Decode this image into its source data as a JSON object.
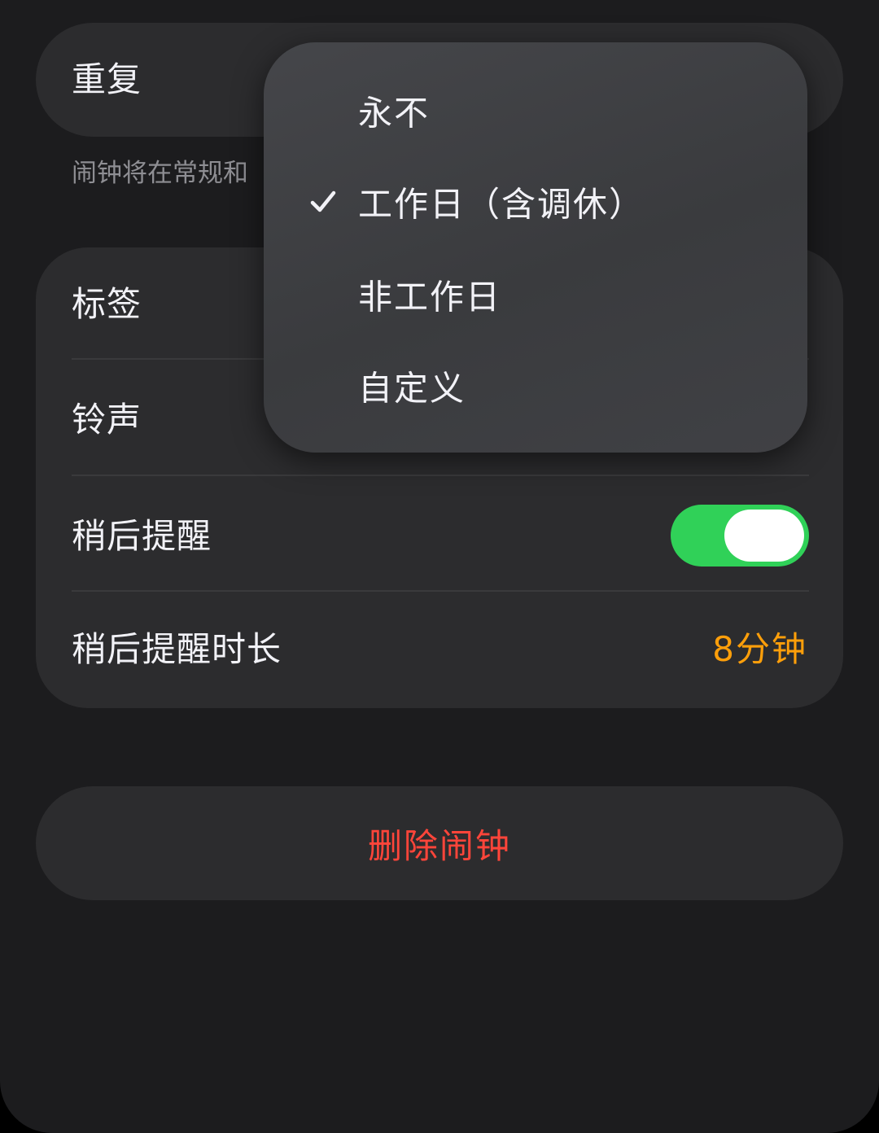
{
  "repeat": {
    "label": "重复",
    "hint": "闹钟将在常规和"
  },
  "settings": {
    "label_row": "标签",
    "ringtone_row": "铃声",
    "snooze_row": "稍后提醒",
    "snooze_enabled": true,
    "snooze_duration_row": "稍后提醒时长",
    "snooze_duration_value": "8分钟"
  },
  "delete_button": "删除闹钟",
  "dropdown": {
    "items": [
      {
        "label": "永不",
        "selected": false
      },
      {
        "label": "工作日（含调休）",
        "selected": true
      },
      {
        "label": "非工作日",
        "selected": false
      },
      {
        "label": "自定义",
        "selected": false
      }
    ],
    "check_icon": "checkmark-icon"
  },
  "colors": {
    "background": "#1c1c1e",
    "card": "#2c2c2e",
    "toggle_on": "#30d158",
    "accent_value": "#ff9f0a",
    "destructive": "#ff453a"
  }
}
